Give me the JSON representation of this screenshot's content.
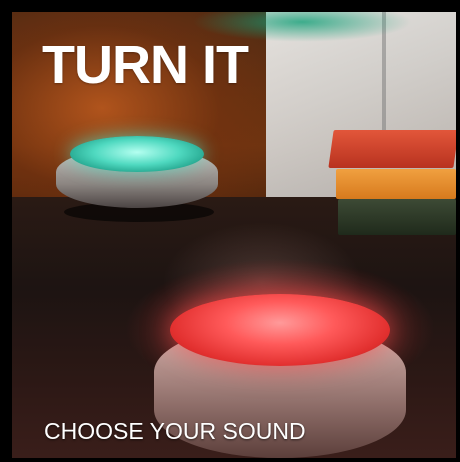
{
  "card": {
    "title": "TURN IT",
    "subtitle": "CHOOSE YOUR SOUND"
  },
  "colors": {
    "accent_teal": "#4fd9c0",
    "accent_red": "#ff5a5a",
    "text": "#ffffff"
  }
}
